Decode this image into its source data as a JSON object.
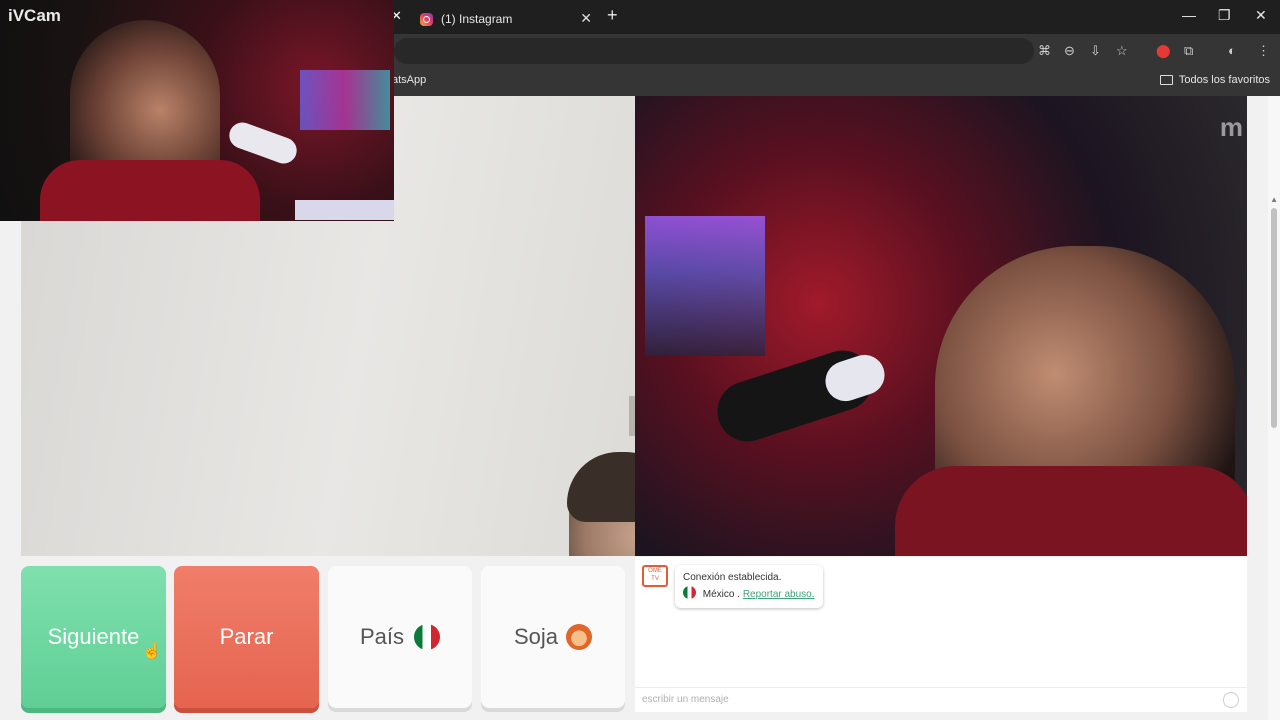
{
  "overlay": {
    "app_label": "iVCam"
  },
  "browser": {
    "tab": {
      "title": "(1) Instagram",
      "close": "✕"
    },
    "prev_tab_close": "✕",
    "new_tab": "+",
    "window_controls": {
      "minimize": "—",
      "restore": "❐",
      "close": "✕"
    },
    "toolbar_icons": {
      "translate": "⌘",
      "zoom": "⊖",
      "install": "⇩",
      "bookmark_star": "☆",
      "extension_red": "⬤",
      "extensions": "⧉",
      "profile": "◐",
      "menu": "⋮"
    },
    "bookmarks": {
      "whatsapp": "atsApp",
      "all_favorites": "Todos los favoritos"
    }
  },
  "video": {
    "watermark": "m"
  },
  "controls": {
    "next": "Siguiente",
    "stop": "Parar",
    "country": "País",
    "gender": "Soja"
  },
  "chat": {
    "logo_text": "OME TV",
    "status": "Conexión establecida.",
    "country": "México",
    "separator": ".",
    "report": "Reportar abuso.",
    "input_placeholder": "escribir un mensaje"
  },
  "colors": {
    "next_green": "#5fcf96",
    "stop_red": "#e5644f",
    "report_link": "#3fa27a"
  }
}
